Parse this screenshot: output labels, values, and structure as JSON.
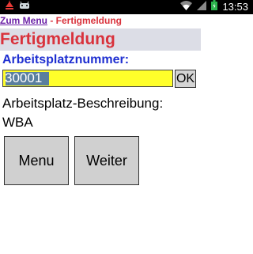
{
  "status_bar": {
    "time": "13:53",
    "left_icons": [
      "alert-icon",
      "android-debug-icon"
    ],
    "right_icons": [
      "wifi-icon",
      "signal-icon",
      "battery-icon"
    ]
  },
  "breadcrumb": {
    "link_label": "Zum Menu",
    "separator": " - ",
    "current": "Fertigmeldung"
  },
  "page": {
    "title": "Fertigmeldung"
  },
  "workplace": {
    "label": "Arbeitsplatznummer:",
    "value": "30001",
    "ok_label": "OK"
  },
  "description": {
    "label": "Arbeitsplatz-Beschreibung:",
    "value": "WBA"
  },
  "buttons": {
    "menu_label": "Menu",
    "next_label": "Weiter"
  },
  "colors": {
    "title_red": "#d9323c",
    "label_blue": "#1f2fd1",
    "input_yellow": "#ffff2a",
    "link_purple": "#6a1fa6",
    "button_gray": "#d0d0d0"
  }
}
